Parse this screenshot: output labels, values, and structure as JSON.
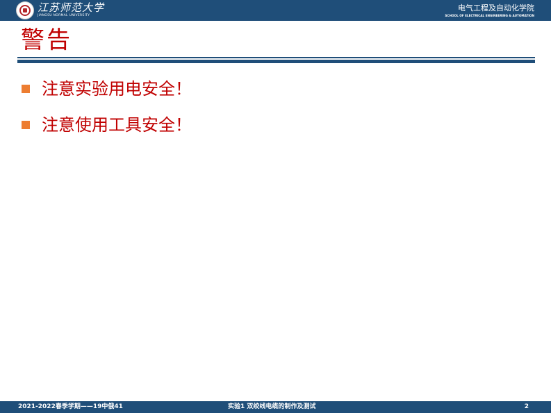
{
  "header": {
    "university_name": "江苏师范大学",
    "university_name_en": "JIANGSU NORMAL UNIVERSITY",
    "school_name": "电气工程及自动化学院",
    "school_name_en": "SCHOOL OF ELECTRICAL ENGINEERING & AUTOMATION",
    "logo_icon": "university-seal-icon"
  },
  "slide": {
    "title": "警告",
    "bullets": [
      {
        "text": "注意实验用电安全！"
      },
      {
        "text": "注意使用工具安全！"
      }
    ]
  },
  "footer": {
    "left": "2021-2022春季学期——19中俄41",
    "center": "实验1 双绞线电缆的制作及测试",
    "page_number": "2"
  },
  "colors": {
    "header_bar": "#1f4e79",
    "title": "#c00000",
    "bullet_text": "#c00000",
    "bullet_marker": "#ed7d31"
  }
}
